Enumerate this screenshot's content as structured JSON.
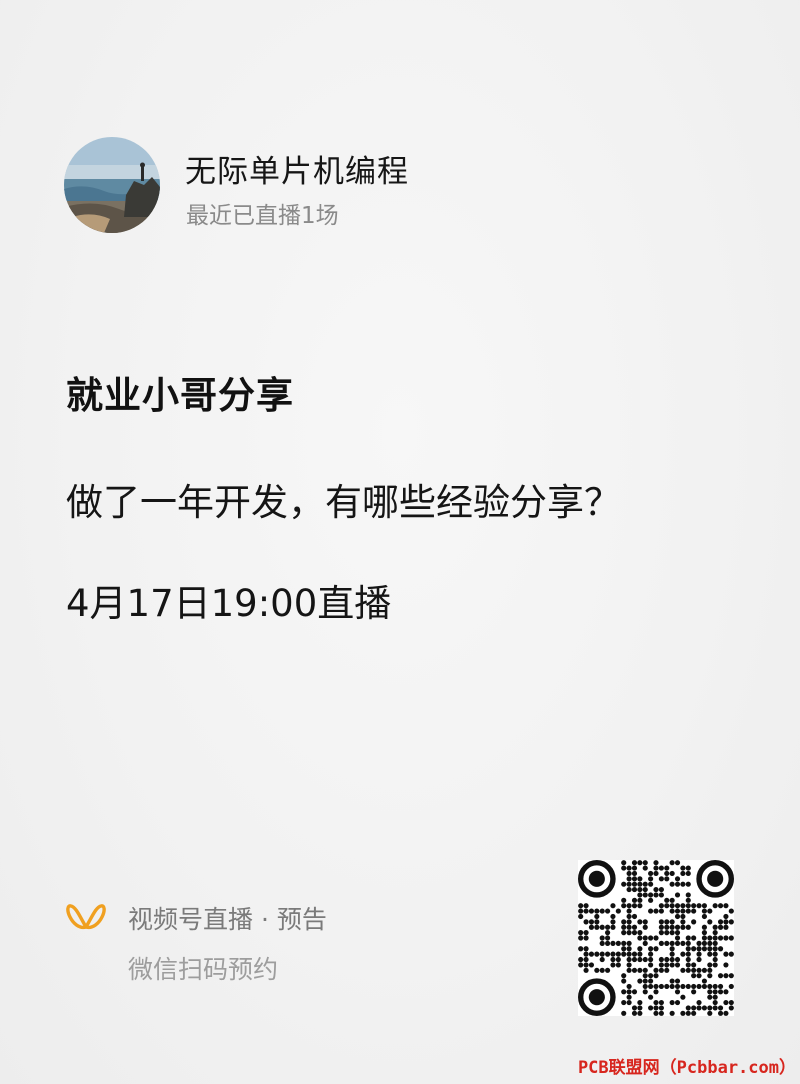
{
  "author": {
    "name": "无际单片机编程",
    "subtitle": "最近已直播1场",
    "avatar": "seaside-landscape-photo"
  },
  "post": {
    "headline": "就业小哥分享",
    "question": "做了一年开发，有哪些经验分享？",
    "datetime": "4月17日19:00直播"
  },
  "footer": {
    "icon": "channels-butterfly-icon",
    "brand_color": "#f0a020",
    "label": "视频号直播 · 预告",
    "hint": "微信扫码预约"
  },
  "qr_code": {
    "icon": "qr-code"
  },
  "watermark": {
    "text": "PCB联盟网（Pcbbar.com）",
    "color": "#d7261e"
  }
}
